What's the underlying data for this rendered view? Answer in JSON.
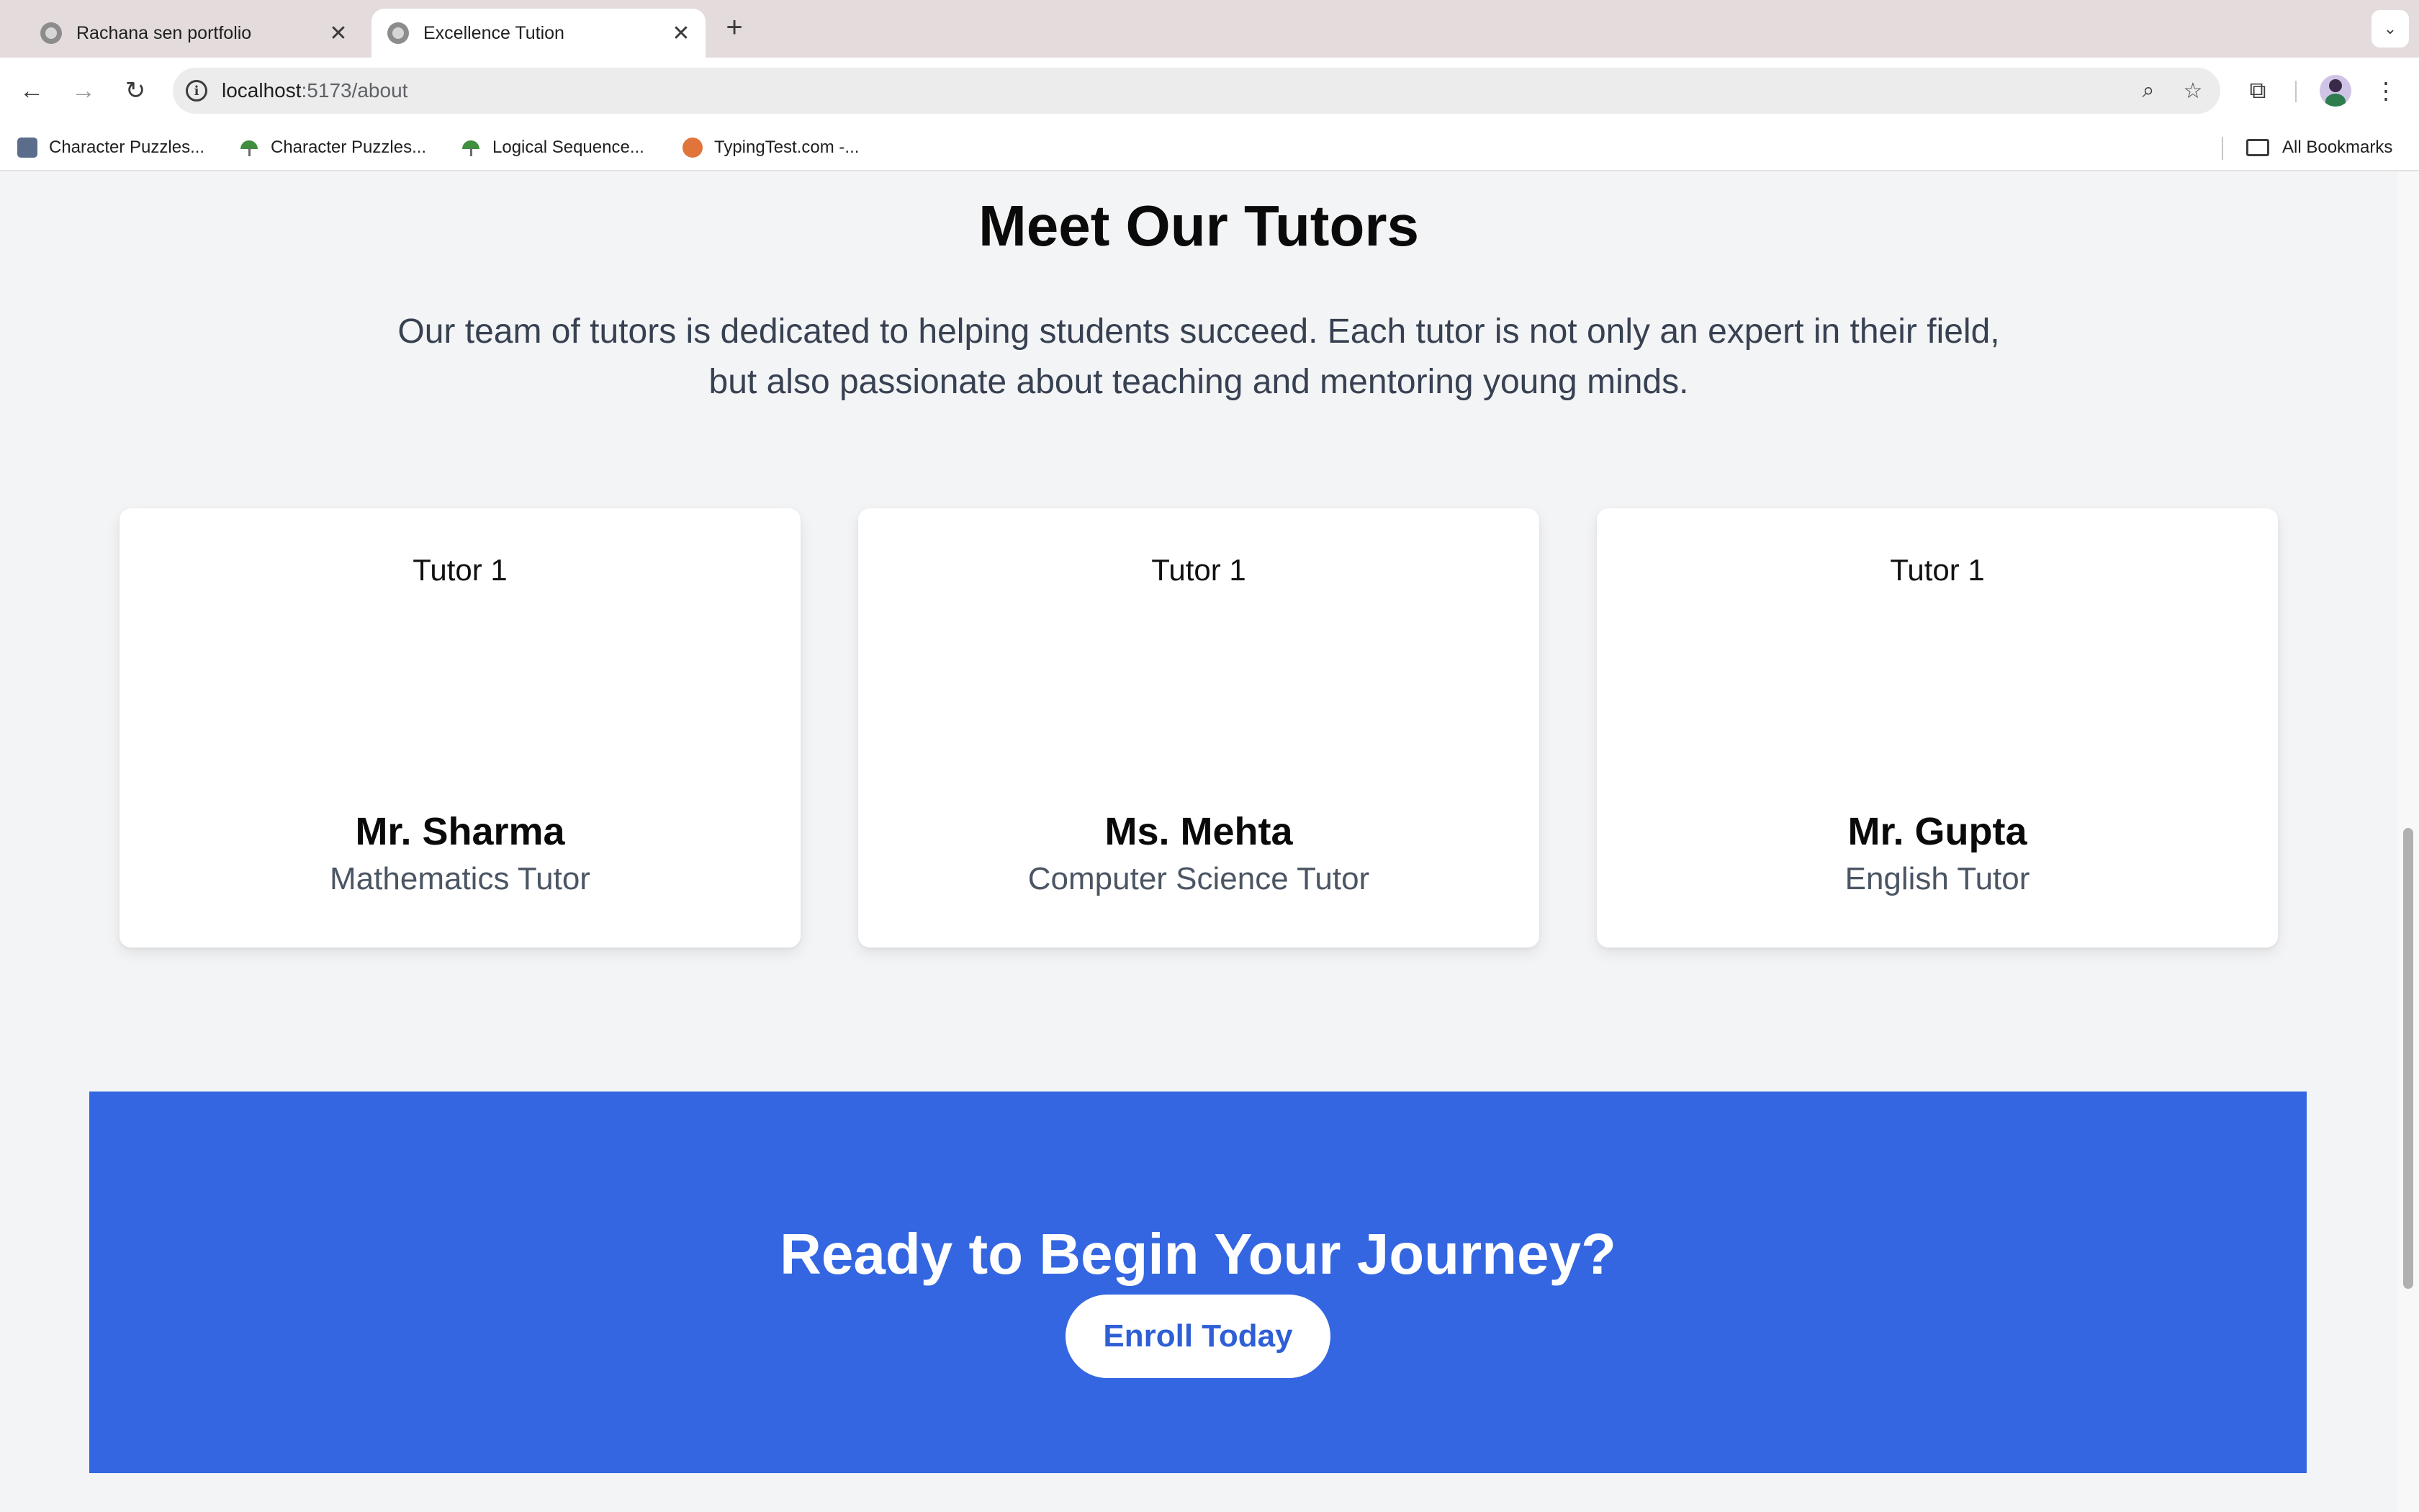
{
  "browser": {
    "tabs": [
      {
        "title": "Rachana sen portfolio",
        "active": false
      },
      {
        "title": "Excellence Tution",
        "active": true
      }
    ],
    "address": {
      "host": "localhost",
      "path": ":5173/about"
    },
    "bookmarks": [
      {
        "label": "Character Puzzles...",
        "icon": "puzzle-icon"
      },
      {
        "label": "Character Puzzles...",
        "icon": "umbrella-icon"
      },
      {
        "label": "Logical Sequence...",
        "icon": "umbrella-icon"
      },
      {
        "label": "TypingTest.com -...",
        "icon": "typing-icon"
      }
    ],
    "all_bookmarks_label": "All Bookmarks"
  },
  "tutors_section": {
    "title": "Meet Our Tutors",
    "description": "Our team of tutors is dedicated to helping students succeed. Each tutor is not only an expert in their field, but also passionate about teaching and mentoring young minds.",
    "tutors": [
      {
        "image_alt": "Tutor 1",
        "name": "Mr. Sharma",
        "subject": "Mathematics Tutor"
      },
      {
        "image_alt": "Tutor 1",
        "name": "Ms. Mehta",
        "subject": "Computer Science Tutor"
      },
      {
        "image_alt": "Tutor 1",
        "name": "Mr. Gupta",
        "subject": "English Tutor"
      }
    ]
  },
  "cta": {
    "title": "Ready to Begin Your Journey?",
    "button_label": "Enroll Today"
  },
  "colors": {
    "page_background": "#f3f4f6",
    "cta_background": "#3366e0",
    "cta_button_text": "#2f5fd6"
  }
}
